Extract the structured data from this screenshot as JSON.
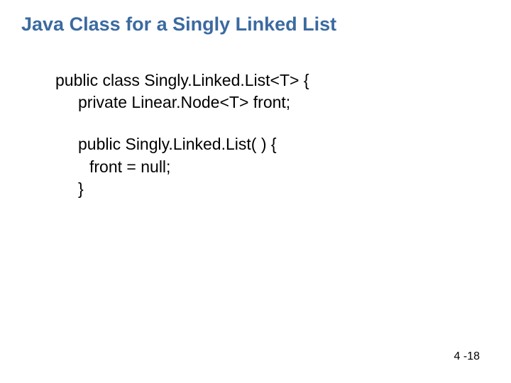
{
  "slide": {
    "title": "Java Class for a Singly Linked List",
    "code": {
      "line1": "public class Singly.Linked.List<T> {",
      "line2": "private Linear.Node<T> front;",
      "line3": "public Singly.Linked.List( ) {",
      "line4": "front = null;",
      "line5": "}"
    },
    "footer": "4 -18"
  }
}
